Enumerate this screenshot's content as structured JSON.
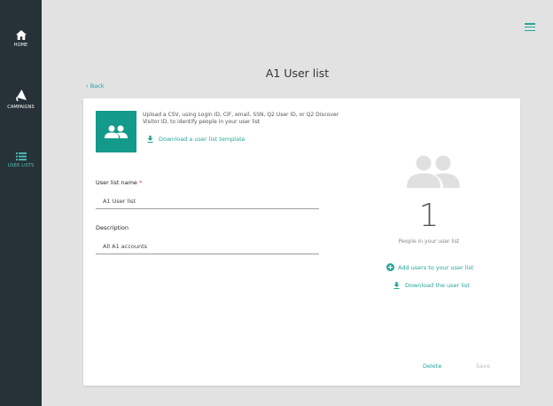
{
  "nav": {
    "home": "HOME",
    "campaigns": "CAMPAIGNS",
    "user_lists": "USER LISTS"
  },
  "page": {
    "title": "A1 User list",
    "back": "Back"
  },
  "upload": {
    "description": "Upload a CSV, using Login ID, CIF, email, SSN, Q2 User ID, or Q2 Discover Visitor ID, to identify people in your user list",
    "template_link": "Download a user list template"
  },
  "form": {
    "name_label": "User list name",
    "name_required": "*",
    "name_value": "A1 User list",
    "description_label": "Description",
    "description_value": "All A1 accounts"
  },
  "summary": {
    "count": "1",
    "count_label": "People in your user list",
    "add_users": "Add users to your user list",
    "download_list": "Download the user list"
  },
  "buttons": {
    "delete": "Delete",
    "save": "Save"
  },
  "colors": {
    "accent": "#26a69a",
    "tile": "#139a8a",
    "sidebar": "#263238",
    "required": "#e53935"
  }
}
